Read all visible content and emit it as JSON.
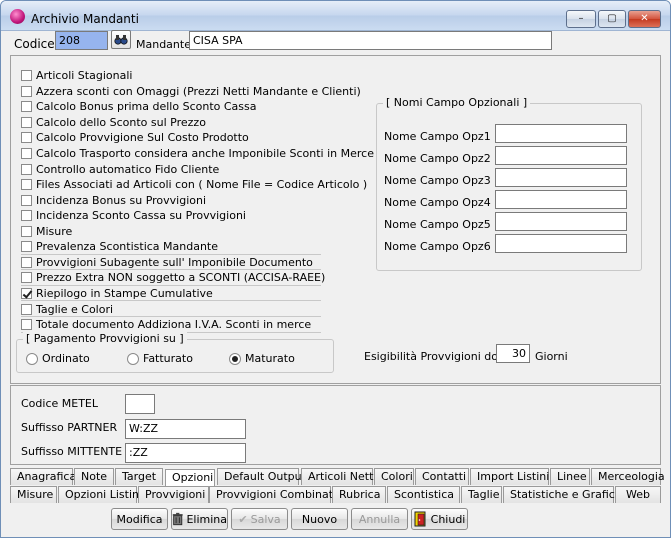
{
  "window": {
    "title": "Archivio Mandanti",
    "minimize": "–",
    "maximize": "▢",
    "close": "✕"
  },
  "header": {
    "codice_label": "Codice",
    "codice_value": "208",
    "mandante_label": "Mandante",
    "mandante_value": "CISA SPA"
  },
  "options": [
    {
      "label": "Articoli Stagionali",
      "checked": false
    },
    {
      "label": "Azzera sconti con Omaggi (Prezzi Netti Mandante e Clienti)",
      "checked": false
    },
    {
      "label": "Calcolo Bonus prima dello Sconto Cassa",
      "checked": false
    },
    {
      "label": "Calcolo dello Sconto sul Prezzo",
      "checked": false
    },
    {
      "label": "Calcolo Provvigione Sul Costo Prodotto",
      "checked": false
    },
    {
      "label": "Calcolo Trasporto considera anche Imponibile Sconti in Merce",
      "checked": false
    },
    {
      "label": "Controllo automatico Fido Cliente",
      "checked": false
    },
    {
      "label": "Files Associati ad Articoli con ( Nome File = Codice Articolo )",
      "checked": false
    },
    {
      "label": "Incidenza Bonus su Provvigioni",
      "checked": false
    },
    {
      "label": "Incidenza Sconto Cassa su Provvigioni",
      "checked": false
    },
    {
      "label": "Misure",
      "checked": false
    },
    {
      "label": "Prevalenza Scontistica Mandante",
      "checked": false
    },
    {
      "label": "Provvigioni Subagente sull' Imponibile Documento",
      "checked": false
    },
    {
      "label": "Prezzo Extra NON soggetto a SCONTI (ACCISA-RAEE)",
      "checked": false
    },
    {
      "label": "Riepilogo in Stampe Cumulative",
      "checked": true
    },
    {
      "label": "Taglie e Colori",
      "checked": false
    },
    {
      "label": "Totale documento  Addiziona I.V.A. Sconti in merce",
      "checked": false
    }
  ],
  "optional_fields": {
    "title": "[ Nomi Campo Opzionali ]",
    "fields": [
      {
        "label": "Nome Campo Opz1",
        "value": ""
      },
      {
        "label": "Nome Campo Opz2",
        "value": ""
      },
      {
        "label": "Nome Campo Opz3",
        "value": ""
      },
      {
        "label": "Nome Campo Opz4",
        "value": ""
      },
      {
        "label": "Nome Campo Opz5",
        "value": ""
      },
      {
        "label": "Nome Campo Opz6",
        "value": ""
      }
    ]
  },
  "pagamento": {
    "title": "[ Pagamento Provvigioni su ]",
    "options": [
      {
        "label": "Ordinato",
        "selected": false
      },
      {
        "label": "Fatturato",
        "selected": false
      },
      {
        "label": "Maturato",
        "selected": true
      }
    ]
  },
  "esigibilita": {
    "label": "Esigibilità Provvigioni dopo",
    "value": "30",
    "unit": "Giorni"
  },
  "extra": {
    "metel_label": "Codice METEL",
    "metel_value": "",
    "partner_label": "Suffisso PARTNER",
    "partner_value": "W:ZZ",
    "mittente_label": "Suffisso MITTENTE",
    "mittente_value": ":ZZ"
  },
  "tabs_row1": [
    "Anagrafica",
    "Note",
    "Target",
    "Opzioni",
    "Default Output",
    "Articoli Netti",
    "Colori",
    "Contatti",
    "Import Listini",
    "Linee",
    "Merceologia"
  ],
  "tabs_row2": [
    "Misure",
    "Opzioni Listini",
    "Provvigioni",
    "Provvigioni Combinate",
    "Rubrica",
    "Scontistica",
    "Taglie",
    "Statistiche e Grafici",
    "Web"
  ],
  "active_tab": "Opzioni",
  "toolbar": {
    "modifica": "Modifica",
    "elimina": "Elimina",
    "salva": "Salva",
    "nuovo": "Nuovo",
    "annulla": "Annulla",
    "chiudi": "Chiudi"
  }
}
